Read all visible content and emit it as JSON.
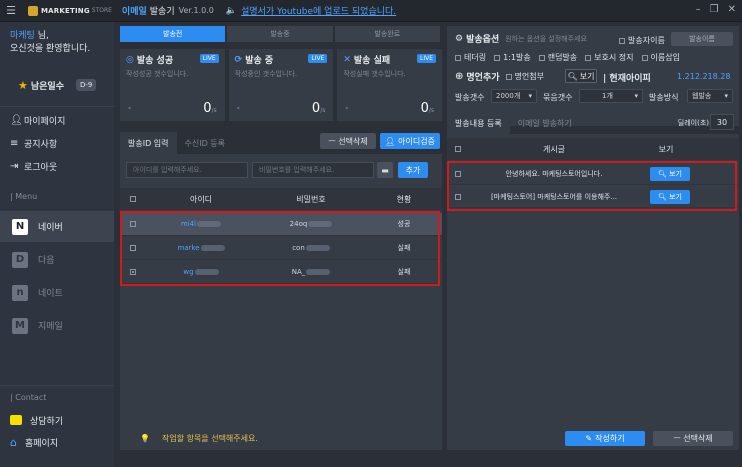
{
  "titlebar": {
    "logo_text": "MARKETING",
    "logo_sub": "STORE",
    "app_name": "이메일",
    "app_name2": "발송기",
    "version": "Ver.1.0.0",
    "notice_icon": "speaker-icon",
    "notice_link": "설명서가 Youtube에 업로드 되었습니다."
  },
  "sidebar": {
    "user_name": "마케팅",
    "user_suffix": " 님,",
    "welcome": "오신것을 환영합니다.",
    "days_label": "남은일수",
    "days_badge": "D-9",
    "nav": [
      {
        "label": "마이페이지",
        "icon": "user-icon"
      },
      {
        "label": "공지사항",
        "icon": "list-icon"
      },
      {
        "label": "로그아웃",
        "icon": "logout-icon"
      }
    ],
    "menu_label": "| Menu",
    "services": [
      {
        "letter": "N",
        "label": "네이버"
      },
      {
        "letter": "D",
        "label": "다음"
      },
      {
        "letter": "n",
        "label": "네이트"
      },
      {
        "letter": "M",
        "label": "지메일"
      }
    ],
    "contact_label": "| Contact",
    "contacts": [
      {
        "label": "상담하기"
      },
      {
        "label": "홈페이지"
      }
    ]
  },
  "steps": [
    "발송전",
    "발송중",
    "발송완료"
  ],
  "stats": [
    {
      "title": "발송 성공",
      "badge": "LIVE",
      "sub": "작성성공 갯수입니다.",
      "value": "0",
      "unit": "/s",
      "dot": "*"
    },
    {
      "title": "발송 중",
      "badge": "LIVE",
      "sub": "작성중인 갯수입니다.",
      "value": "0",
      "unit": "/s",
      "dot": "*"
    },
    {
      "title": "발송 실패",
      "badge": "LIVE",
      "sub": "작성실패 갯수입니다.",
      "value": "0",
      "unit": "/s",
      "dot": "*"
    }
  ],
  "left_tabs": [
    "발송ID 입력",
    "수신ID 등록"
  ],
  "left_buttons": {
    "delete_selected": "ㅡ 선택삭제",
    "verify_id": "아이디검증",
    "add": "추가"
  },
  "inputs": {
    "id_placeholder": "아이디를 입력해주세요.",
    "pw_placeholder": "비밀번호를 입력해주세요."
  },
  "table": {
    "headers": [
      "아이디",
      "비밀번호",
      "현황"
    ],
    "rows": [
      {
        "id": "mi4l",
        "pw": "24oq",
        "status": "성공"
      },
      {
        "id": "marke",
        "pw": "con",
        "status": "실패"
      },
      {
        "id": "wg",
        "pw": "NA_",
        "status": "실패"
      }
    ]
  },
  "hint": "작업할 항목을 선택해주세요.",
  "options": {
    "title": "발송옵션",
    "subtitle": "원하는 옵션을 설정해주세요",
    "sender_name_chk": "발송자이름",
    "sender_name_input": "발송이름",
    "checks": [
      "테더링",
      "1:1발송",
      "랜덤발송",
      "보호시 정지",
      "이름삽입"
    ],
    "card_add": "명언추가",
    "card_attach": "명언첨부",
    "view": "보기",
    "current_ip_label": "| 현재아이피",
    "current_ip": "1.212.218.28",
    "send_count_label": "발송갯수",
    "send_count": "2000개",
    "group_count_label": "묶음갯수",
    "group_count": "1개",
    "method_label": "발송방식",
    "method": "웹발송"
  },
  "right_tabs": [
    "발송내용 등록",
    "이메일 발송하기"
  ],
  "delay": {
    "label": "딜레이(초)",
    "value": "30"
  },
  "posts": {
    "headers": [
      "게시글",
      "보기"
    ],
    "rows": [
      {
        "title": "안녕하세요. 마케팅스토어입니다.",
        "view": "보기"
      },
      {
        "title": "[마케팅스토어] 마케팅스토어를 이용해주...",
        "view": "보기"
      }
    ]
  },
  "right_buttons": {
    "write": "작성하기",
    "delete": "ㅡ 선택삭제"
  }
}
